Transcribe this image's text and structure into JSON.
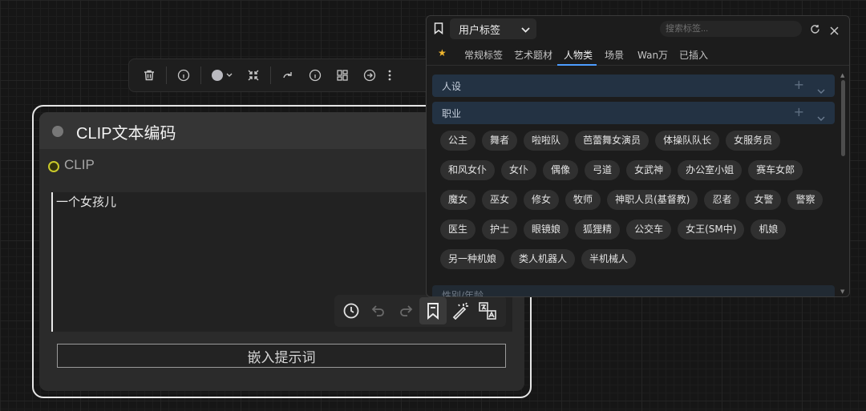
{
  "node_toolbar": {
    "icons": [
      "trash-icon",
      "info-icon",
      "color-picker",
      "chevron-down-icon",
      "collapse-icon",
      "redo-icon",
      "info-icon",
      "layout-icon",
      "arrow-right-circle-icon",
      "more-icon"
    ],
    "color_swatch": "#b9b9bf"
  },
  "node": {
    "title": "CLIP文本编码",
    "input_label": "CLIP",
    "input_port_color": "#c9c92a",
    "prompt_text": "一个女孩儿",
    "embed_button": "嵌入提示词",
    "prompt_tools": [
      "history-icon",
      "undo-icon",
      "redo-icon",
      "bookmark-icon",
      "magic-wand-icon",
      "translate-icon"
    ]
  },
  "tag_panel": {
    "dropdown_label": "用户标签",
    "search_placeholder": "搜索标签...",
    "tabs": [
      "常规标签",
      "艺术题材",
      "人物类",
      "场景",
      "Wan万",
      "已插入"
    ],
    "active_tab": "人物类",
    "favorite_symbol": "★",
    "categories": [
      {
        "name": "人设",
        "expanded": false
      },
      {
        "name": "职业",
        "expanded": true
      },
      {
        "name": "性别/年龄",
        "expanded": false
      }
    ],
    "tags": [
      [
        "公主",
        "舞者",
        "啦啦队",
        "芭蕾舞女演员",
        "体操队队长",
        "女服务员"
      ],
      [
        "和风女仆",
        "女仆",
        "偶像",
        "弓道",
        "女武神",
        "办公室小姐",
        "赛车女郎"
      ],
      [
        "魔女",
        "巫女",
        "修女",
        "牧师",
        "神职人员(基督教)",
        "忍者",
        "女警",
        "警察"
      ],
      [
        "医生",
        "护士",
        "眼镜娘",
        "狐狸精",
        "公交车",
        "女王(SM中)",
        "机娘"
      ],
      [
        "另一种机娘",
        "类人机器人",
        "半机械人"
      ]
    ],
    "accent_color": "#4d9dff",
    "category_color": "#233243"
  }
}
